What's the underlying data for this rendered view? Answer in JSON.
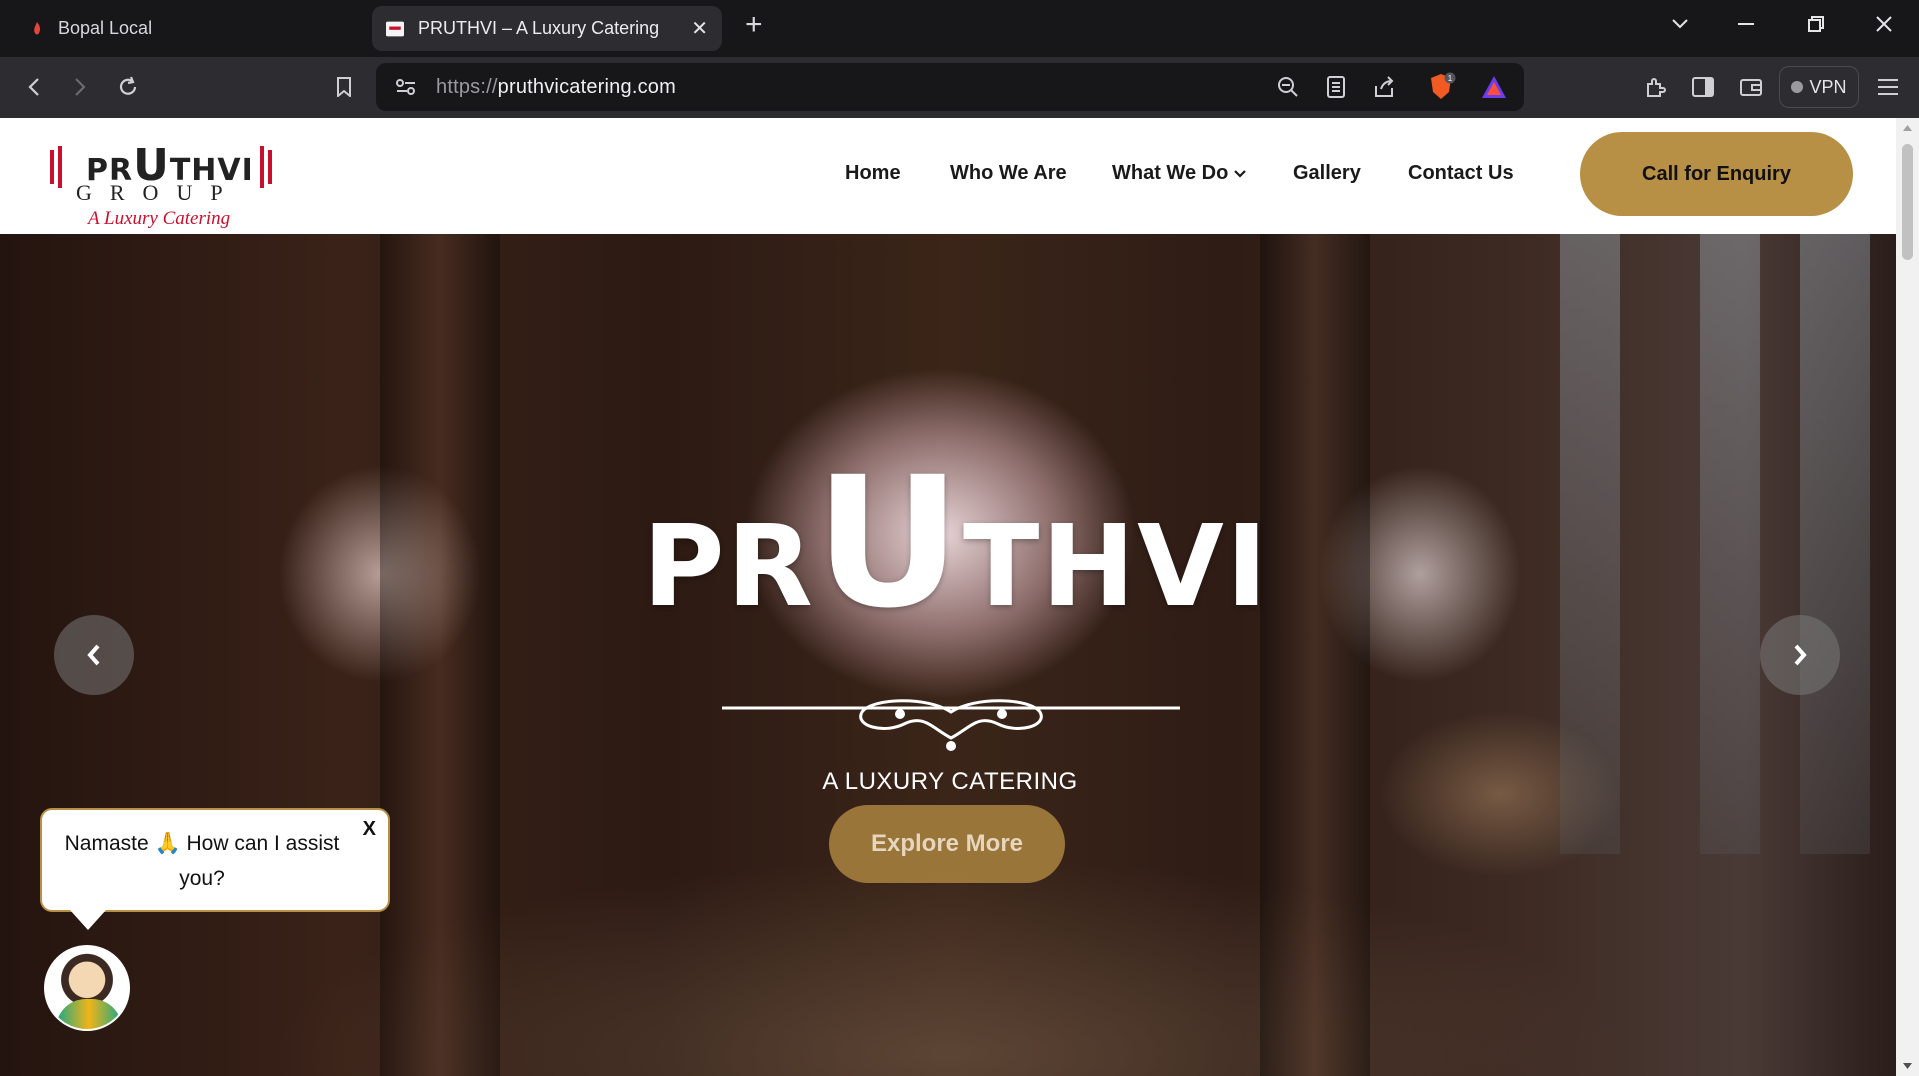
{
  "browser": {
    "tabs": [
      {
        "title": "Bopal Local",
        "active": false
      },
      {
        "title": "PRUTHVI – A Luxury Catering",
        "active": true
      }
    ],
    "url": {
      "scheme": "https://",
      "host": "pruthvicatering.com"
    },
    "vpn_label": "VPN",
    "shield_badge": "1"
  },
  "header": {
    "logo": {
      "word_pre": "PR",
      "word_u": "U",
      "word_post": "THVI",
      "group": "GROUP",
      "tagline": "A Luxury Catering"
    },
    "nav": [
      {
        "label": "Home"
      },
      {
        "label": "Who We Are"
      },
      {
        "label": "What We Do"
      },
      {
        "label": "Gallery"
      },
      {
        "label": "Contact Us"
      }
    ],
    "cta_label": "Call for Enquiry"
  },
  "hero": {
    "brand_pre": "PR",
    "brand_u": "U",
    "brand_post": "THVI",
    "tagline": "A LUXURY CATERING",
    "button_label": "Explore More"
  },
  "chat": {
    "message": "Namaste 🙏 How can I assist you?",
    "close_label": "X"
  },
  "colors": {
    "accent": "#b78f45",
    "logo_red": "#c8102e"
  }
}
